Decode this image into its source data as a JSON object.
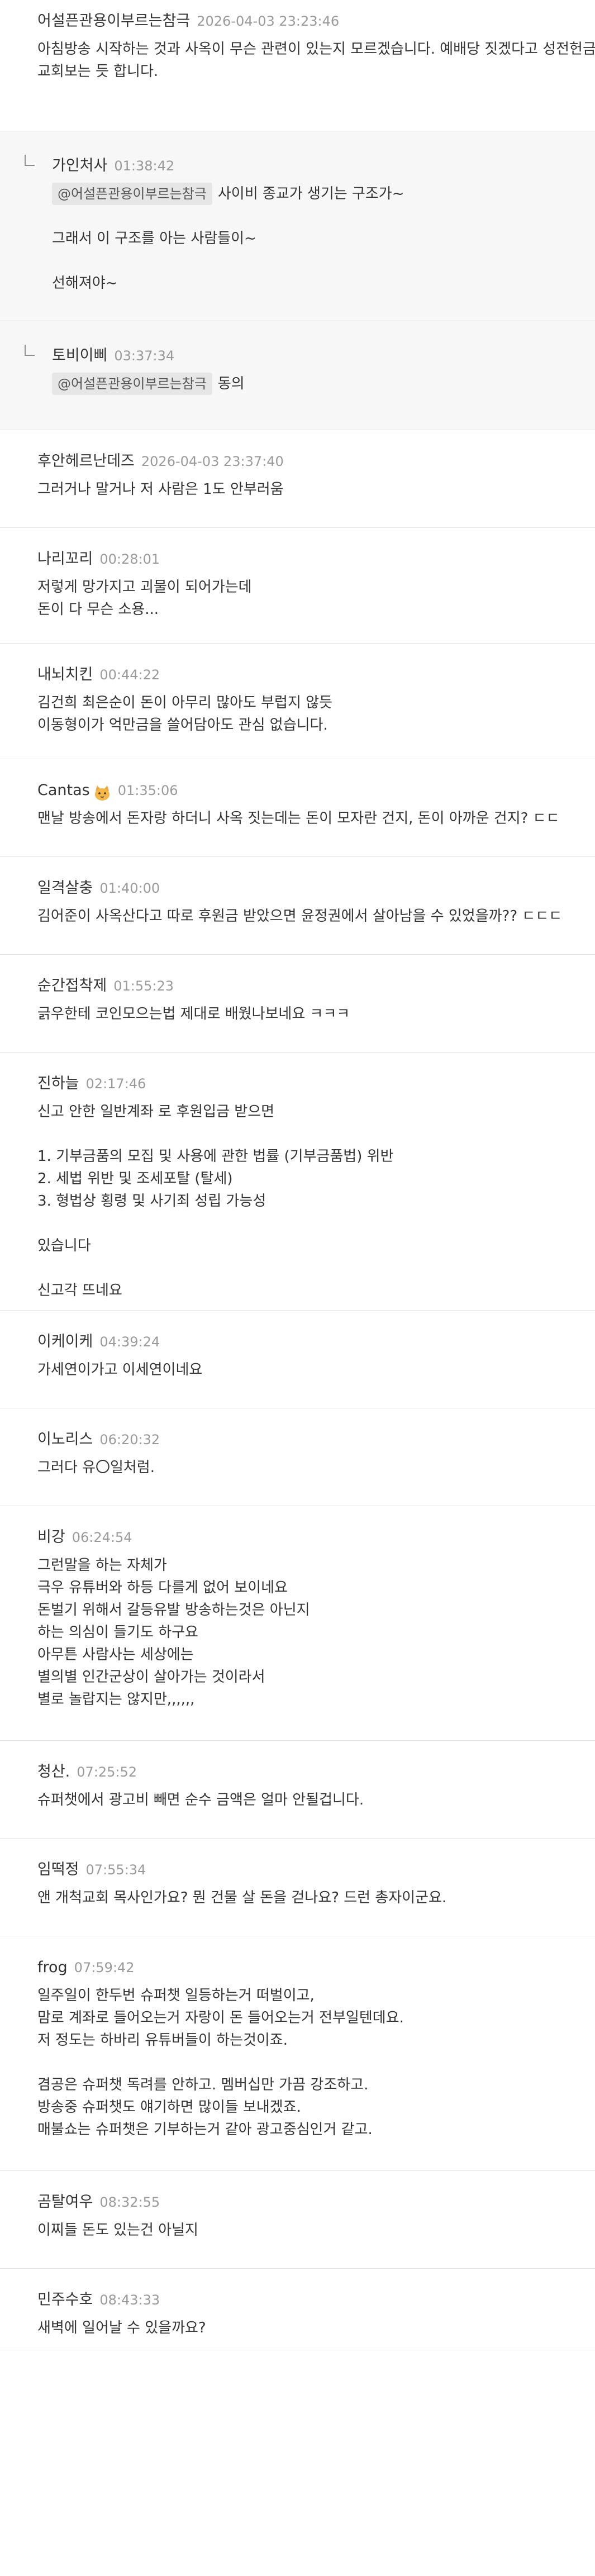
{
  "comments": [
    {
      "author": "어설픈관용이부르는참극",
      "time": "2026-04-03 23:23:46",
      "reply": false,
      "mention": "",
      "lines": [
        "아침방송 시작하는 것과 사옥이 무슨 관련이 있는지 모르겠습니다. 예배당 짓겠다고 성전헌금 걷는",
        "교회보는 듯 합니다."
      ]
    },
    {
      "author": "가인처사",
      "time": "01:38:42",
      "reply": true,
      "mention": "@어설픈관용이부르는참극",
      "lines": [
        "사이비 종교가 생기는 구조가~",
        "",
        "그래서 이 구조를 아는 사람들이~",
        "",
        "선해져야~"
      ]
    },
    {
      "author": "토비이삐",
      "time": "03:37:34",
      "reply": true,
      "mention": "@어설픈관용이부르는참극",
      "lines": [
        "동의"
      ]
    },
    {
      "author": "후안헤르난데즈",
      "time": "2026-04-03 23:37:40",
      "reply": false,
      "mention": "",
      "lines": [
        "그러거나 말거나 저 사람은 1도 안부러움"
      ]
    },
    {
      "author": "나리꼬리",
      "time": "00:28:01",
      "reply": false,
      "mention": "",
      "lines": [
        "저렇게 망가지고 괴물이 되어가는데",
        "돈이 다 무슨 소용..."
      ]
    },
    {
      "author": "내뇌치킨",
      "time": "00:44:22",
      "reply": false,
      "mention": "",
      "lines": [
        "김건희 최은순이 돈이 아무리 많아도 부럽지 않듯",
        "이동형이가 억만금을 쓸어담아도 관심 없습니다."
      ]
    },
    {
      "author": "Cantas",
      "time": "01:35:06",
      "reply": false,
      "mention": "",
      "emoji": "cat-emoji-icon",
      "lines": [
        "맨날 방송에서 돈자랑 하더니 사옥 짓는데는 돈이 모자란 건지, 돈이 아까운 건지? ㄷㄷ"
      ]
    },
    {
      "author": "일격살충",
      "time": "01:40:00",
      "reply": false,
      "mention": "",
      "lines": [
        "김어준이 사옥산다고 따로 후원금 받았으면 윤정권에서 살아남을 수 있었을까?? ㄷㄷㄷ"
      ]
    },
    {
      "author": "순간접착제",
      "time": "01:55:23",
      "reply": false,
      "mention": "",
      "lines": [
        "긁우한테 코인모으는법 제대로 배웠나보네요 ㅋㅋㅋ"
      ]
    },
    {
      "author": "진하늘",
      "time": "02:17:46",
      "reply": false,
      "mention": "",
      "lines": [
        "신고 안한 일반계좌 로 후원입금 받으면",
        "",
        "1. 기부금품의 모집 및 사용에 관한 법률 (기부금품법) 위반",
        "2. 세법 위반 및 조세포탈 (탈세)",
        "3. 형법상 횡령 및 사기죄 성립 가능성",
        "",
        "있습니다",
        "",
        "신고각 뜨네요"
      ]
    },
    {
      "author": "이케이케",
      "time": "04:39:24",
      "reply": false,
      "mention": "",
      "lines": [
        "가세연이가고 이세연이네요"
      ]
    },
    {
      "author": "이노리스",
      "time": "06:20:32",
      "reply": false,
      "mention": "",
      "lines": [
        "그러다 유〇일처럼."
      ]
    },
    {
      "author": "비강",
      "time": "06:24:54",
      "reply": false,
      "mention": "",
      "lines": [
        "그런말을 하는 자체가",
        "극우 유튜버와 하등 다를게 없어 보이네요",
        "돈벌기 위해서 갈등유발 방송하는것은 아닌지",
        "하는 의심이 들기도 하구요",
        "아무튼 사람사는 세상에는",
        "별의별 인간군상이 살아가는 것이라서",
        "별로 놀랍지는 않지만,,,,,,"
      ]
    },
    {
      "author": "청산.",
      "time": "07:25:52",
      "reply": false,
      "mention": "",
      "lines": [
        "슈퍼챗에서 광고비 빼면 순수 금액은 얼마 안될겁니다."
      ]
    },
    {
      "author": "임떡정",
      "time": "07:55:34",
      "reply": false,
      "mention": "",
      "lines": [
        "앤 개척교회 목사인가요? 뭔 건물 살 돈을 걷나요? 드런 총자이군요."
      ]
    },
    {
      "author": "frog",
      "time": "07:59:42",
      "reply": false,
      "mention": "",
      "lines": [
        "일주일이 한두번 슈퍼챗 일등하는거 떠벌이고,",
        "맘로 계좌로 들어오는거 자랑이 돈 들어오는거 전부일텐데요.",
        "저 정도는 하바리 유튜버들이 하는것이죠.",
        "",
        "겸공은 슈퍼챗 독려를 안하고. 멤버십만 가끔 강조하고.",
        "방송중 슈퍼챗도 얘기하면 많이들 보내겠죠.",
        "매불쇼는 슈퍼챗은 기부하는거 같아 광고중심인거 같고."
      ]
    },
    {
      "author": "곰탈여우",
      "time": "08:32:55",
      "reply": false,
      "mention": "",
      "lines": [
        "이찌들 돈도 있는건 아닐지"
      ]
    },
    {
      "author": "민주수호",
      "time": "08:43:33",
      "reply": false,
      "mention": "",
      "lines": [
        "새벽에 일어날 수 있을까요?"
      ]
    }
  ]
}
